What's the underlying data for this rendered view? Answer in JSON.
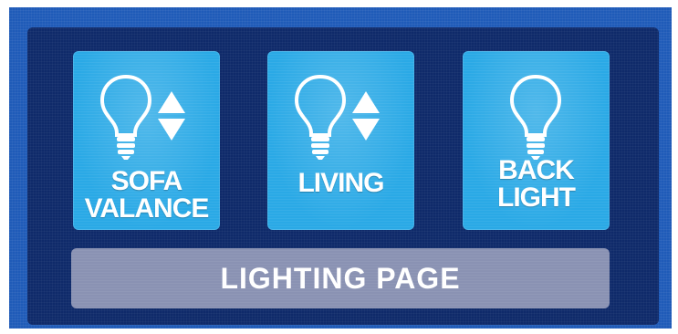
{
  "screen": {
    "background_color": "#1f5bb8",
    "panel_color": "#0f2a6a",
    "tile_color": "#2aa9e6",
    "bar_color": "#8a92b3"
  },
  "tiles": [
    {
      "line1": "SOFA",
      "line2": "VALANCE",
      "icon": "lightbulb-icon",
      "dimmer": true
    },
    {
      "line1": "LIVING",
      "line2": "",
      "icon": "lightbulb-icon",
      "dimmer": true
    },
    {
      "line1": "BACK",
      "line2": "LIGHT",
      "icon": "lightbulb-icon",
      "dimmer": false
    }
  ],
  "page_bar": {
    "label": "LIGHTING PAGE"
  }
}
